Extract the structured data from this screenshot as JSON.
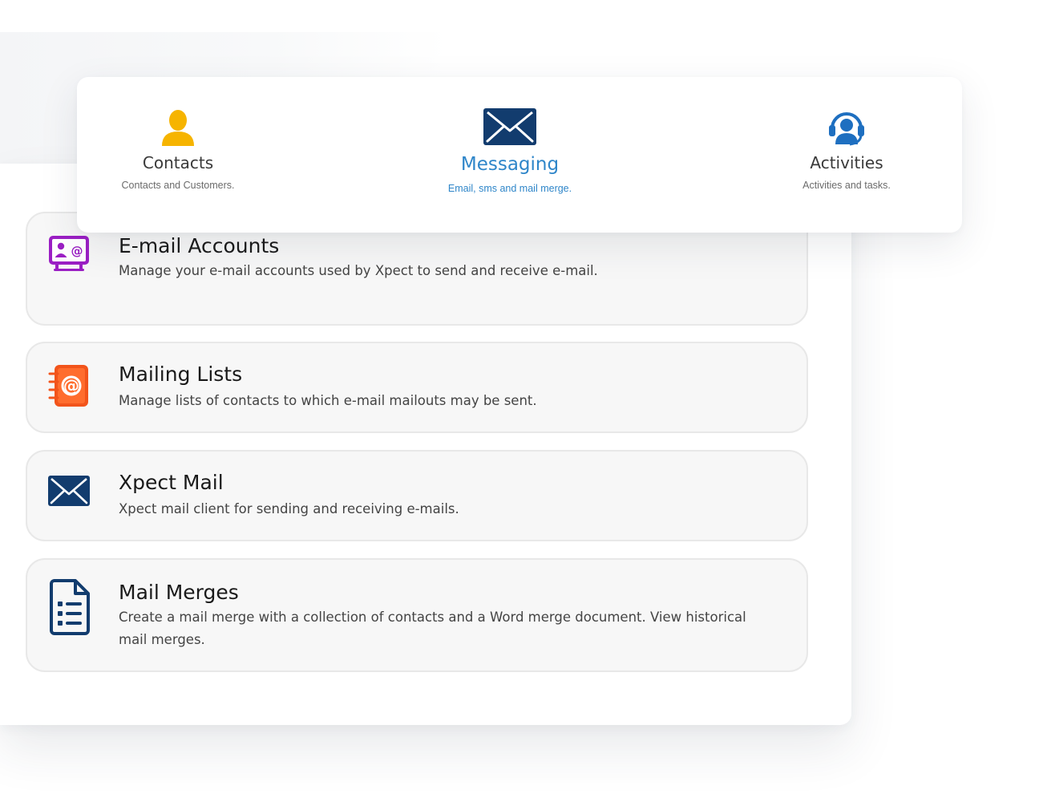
{
  "nav": {
    "items": [
      {
        "label": "Contacts",
        "subtitle": "Contacts and Customers.",
        "icon": "person-icon",
        "active": false
      },
      {
        "label": "Messaging",
        "subtitle": "Email, sms and mail merge.",
        "icon": "envelope-icon",
        "active": true
      },
      {
        "label": "Activities",
        "subtitle": "Activities and tasks.",
        "icon": "headset-icon",
        "active": false
      }
    ]
  },
  "modules": [
    {
      "title": "E-mail Accounts",
      "description": "Manage your e-mail accounts used by Xpect to send and receive e-mail.",
      "icon": "email-account-icon"
    },
    {
      "title": "Mailing Lists",
      "description": "Manage lists of contacts to which e-mail mailouts may be sent.",
      "icon": "address-book-icon"
    },
    {
      "title": "Xpect Mail",
      "description": "Xpect mail client for sending and receiving e-mails.",
      "icon": "envelope-icon"
    },
    {
      "title": "Mail Merges",
      "description": "Create a mail merge with a collection of contacts and a Word merge document. View historical mail merges.",
      "icon": "document-list-icon"
    }
  ],
  "colors": {
    "accent": "#2f86c9",
    "contacts_icon": "#f6b400",
    "email_accounts_icon": "#9b1fc4",
    "mailing_lists_icon": "#f2541b",
    "navy_icon": "#123c6e",
    "activities_icon": "#1e6fc0"
  }
}
